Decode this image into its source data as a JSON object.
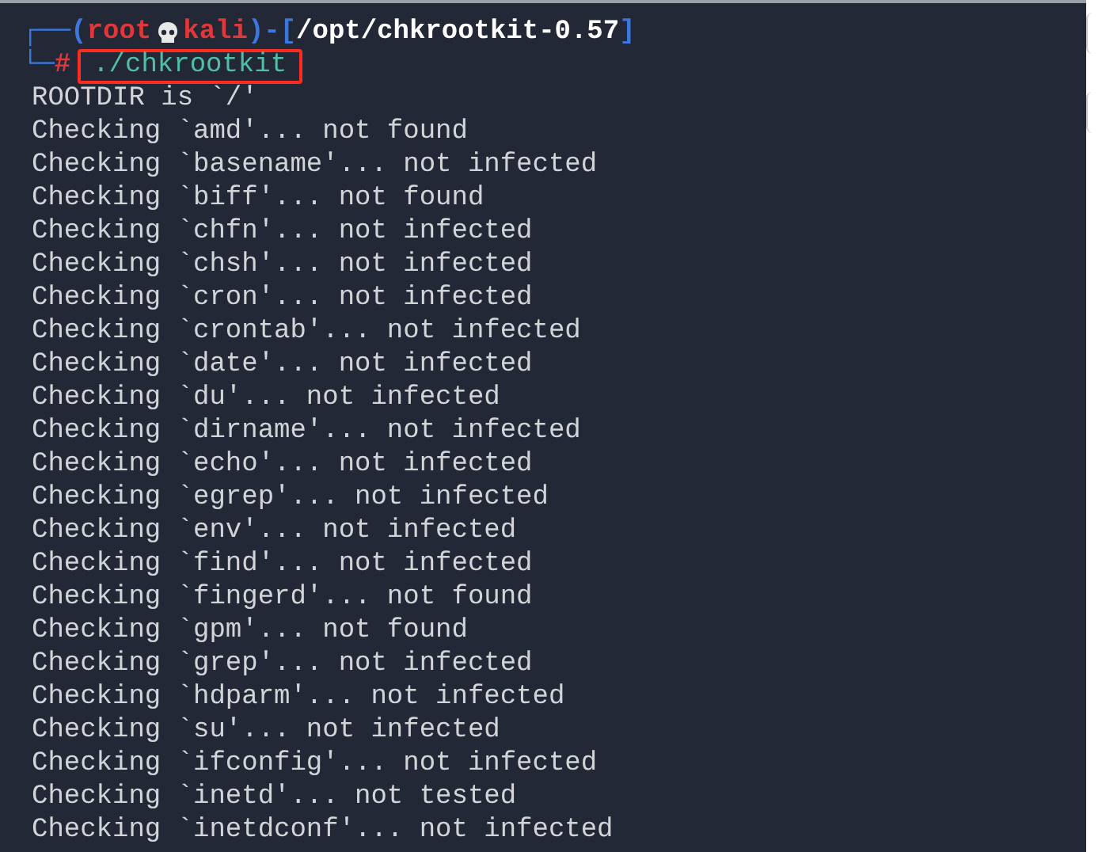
{
  "prompt": {
    "corner_top": "┌──(",
    "user": "root",
    "host": "kali",
    "separator": ")-[",
    "path": "/opt/chkrootkit-0.57",
    "close": "]",
    "corner_bottom": "└─",
    "symbol": "#",
    "command": "./chkrootkit",
    "command_highlighted": true
  },
  "output": [
    "ROOTDIR is `/'",
    "Checking `amd'... not found",
    "Checking `basename'... not infected",
    "Checking `biff'... not found",
    "Checking `chfn'... not infected",
    "Checking `chsh'... not infected",
    "Checking `cron'... not infected",
    "Checking `crontab'... not infected",
    "Checking `date'... not infected",
    "Checking `du'... not infected",
    "Checking `dirname'... not infected",
    "Checking `echo'... not infected",
    "Checking `egrep'... not infected",
    "Checking `env'... not infected",
    "Checking `find'... not infected",
    "Checking `fingerd'... not found",
    "Checking `gpm'... not found",
    "Checking `grep'... not infected",
    "Checking `hdparm'... not infected",
    "Checking `su'... not infected",
    "Checking `ifconfig'... not infected",
    "Checking `inetd'... not tested",
    "Checking `inetdconf'... not infected"
  ]
}
